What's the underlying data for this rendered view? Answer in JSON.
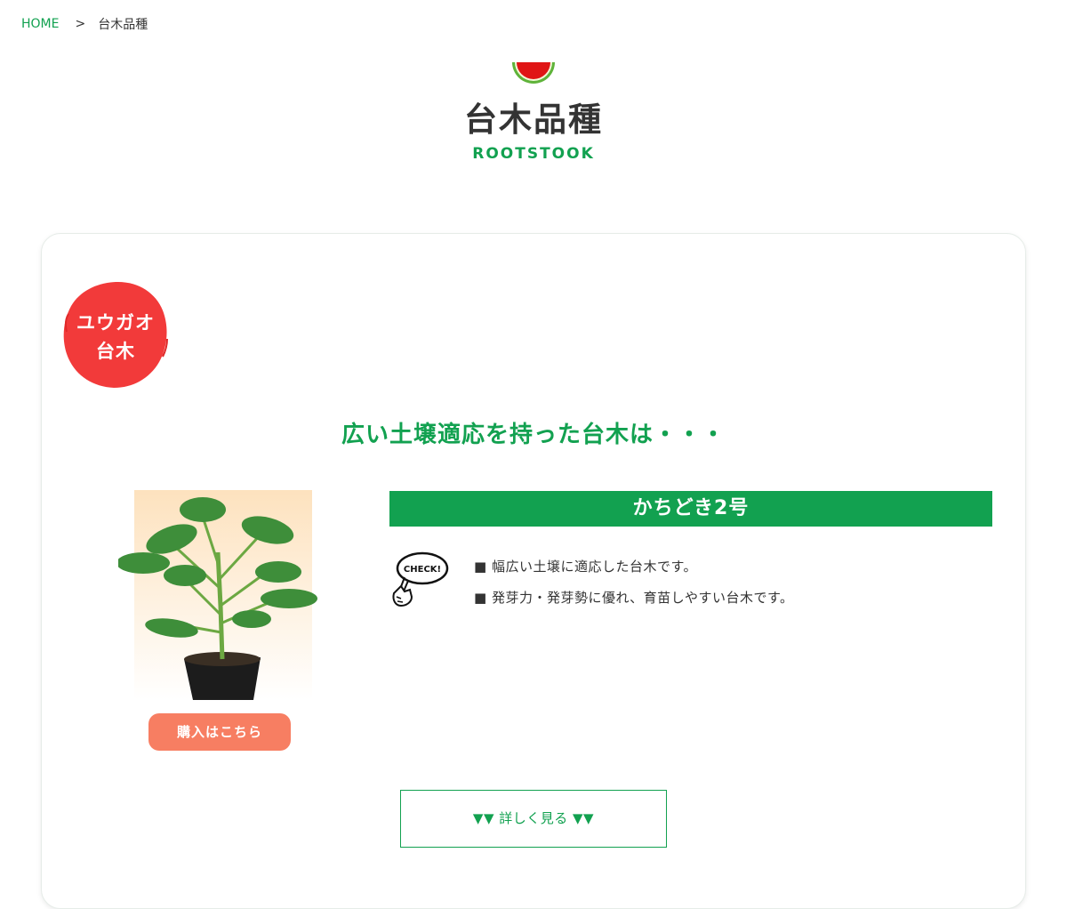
{
  "breadcrumb": {
    "home": "HOME",
    "separator": ">",
    "current": "台木品種"
  },
  "header": {
    "icon": "watermelon-icon",
    "title": "台木品種",
    "subtitle": "ROOTSTOOK"
  },
  "card": {
    "badge": {
      "line1": "ユウガオ",
      "line2": "台木",
      "color": "#f23a3a"
    },
    "catchphrase": "広い土壌適応を持った台木は・・・",
    "product": {
      "photo": "potted-seedling-image",
      "buy_label": "購入はこちら",
      "name": "かちどき2号",
      "check_icon": "check-pointing-hand-icon",
      "check_label": "CHECK!",
      "features": [
        "■ 幅広い土壌に適応した台木です。",
        "■ 発芽力・発芽勢に優れ、育苗しやすい台木です。"
      ]
    },
    "more_label": "▼▼ 詳しく見る ▼▼"
  },
  "colors": {
    "accent_green": "#12a150",
    "buy_button": "#f77e62",
    "badge_red": "#f23a3a"
  }
}
